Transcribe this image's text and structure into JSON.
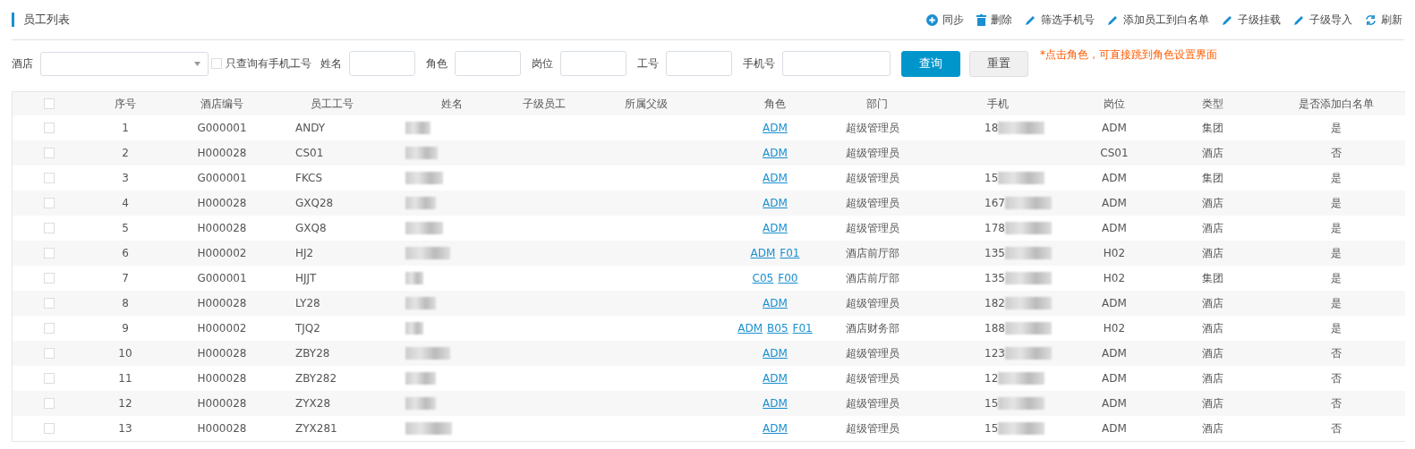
{
  "header": {
    "title": "员工列表",
    "actions": [
      {
        "kind": "add",
        "label": "同步"
      },
      {
        "kind": "delete",
        "label": "删除"
      },
      {
        "kind": "edit",
        "label": "筛选手机号"
      },
      {
        "kind": "edit",
        "label": "添加员工到白名单"
      },
      {
        "kind": "edit",
        "label": "子级挂载"
      },
      {
        "kind": "edit",
        "label": "子级导入"
      },
      {
        "kind": "refresh",
        "label": "刷新"
      }
    ]
  },
  "filters": {
    "hotel_label": "酒店",
    "phone_only": {
      "label": "只查询有手机工号",
      "checked": false
    },
    "fields": [
      {
        "label": "姓名"
      },
      {
        "label": "角色"
      },
      {
        "label": "岗位"
      },
      {
        "label": "工号"
      },
      {
        "label": "手机号"
      }
    ],
    "search_button": "查询",
    "reset_button": "重置",
    "note": "*点击角色，可直接跳到角色设置界面"
  },
  "table": {
    "header_checked": false,
    "columns": [
      "序号",
      "酒店编号",
      "员工工号",
      "姓名",
      "子级员工",
      "所属父级",
      "角色",
      "部门",
      "手机",
      "岗位",
      "类型",
      "是否添加白名单"
    ],
    "rows": [
      {
        "checked": false,
        "no": "1",
        "hotel": "G000001",
        "emp": "ANDY",
        "roles": [
          "ADM"
        ],
        "dept": "超级管理员",
        "phone": "18",
        "post": "ADM",
        "type": "集团",
        "whitelist": "是"
      },
      {
        "checked": false,
        "no": "2",
        "hotel": "H000028",
        "emp": "CS01",
        "roles": [
          "ADM"
        ],
        "dept": "超级管理员",
        "post": "CS01",
        "type": "酒店",
        "whitelist": "否"
      },
      {
        "checked": false,
        "no": "3",
        "hotel": "G000001",
        "emp": "FKCS",
        "roles": [
          "ADM"
        ],
        "dept": "超级管理员",
        "phone": "15",
        "post": "ADM",
        "type": "集团",
        "whitelist": "是"
      },
      {
        "checked": false,
        "no": "4",
        "hotel": "H000028",
        "emp": "GXQ28",
        "roles": [
          "ADM"
        ],
        "dept": "超级管理员",
        "phone": "167",
        "post": "ADM",
        "type": "酒店",
        "whitelist": "是"
      },
      {
        "checked": false,
        "no": "5",
        "hotel": "H000028",
        "emp": "GXQ8",
        "roles": [
          "ADM"
        ],
        "dept": "超级管理员",
        "phone": "178",
        "post": "ADM",
        "type": "酒店",
        "whitelist": "是"
      },
      {
        "checked": false,
        "no": "6",
        "hotel": "H000002",
        "emp": "HJ2",
        "roles": [
          "ADM",
          "F01"
        ],
        "dept": "酒店前厅部",
        "phone": "135",
        "post": "H02",
        "type": "酒店",
        "whitelist": "是"
      },
      {
        "checked": false,
        "no": "7",
        "hotel": "G000001",
        "emp": "HJJT",
        "roles": [
          "C05",
          "F00"
        ],
        "dept": "酒店前厅部",
        "phone": "135",
        "post": "H02",
        "type": "集团",
        "whitelist": "是"
      },
      {
        "checked": false,
        "no": "8",
        "hotel": "H000028",
        "emp": "LY28",
        "roles": [
          "ADM"
        ],
        "dept": "超级管理员",
        "phone": "182",
        "post": "ADM",
        "type": "酒店",
        "whitelist": "是"
      },
      {
        "checked": false,
        "no": "9",
        "hotel": "H000002",
        "emp": "TJQ2",
        "roles": [
          "ADM",
          "B05",
          "F01"
        ],
        "dept": "酒店财务部",
        "phone": "188",
        "post": "H02",
        "type": "酒店",
        "whitelist": "是"
      },
      {
        "checked": false,
        "no": "10",
        "hotel": "H000028",
        "emp": "ZBY28",
        "roles": [
          "ADM"
        ],
        "dept": "超级管理员",
        "phone": "123",
        "post": "ADM",
        "type": "酒店",
        "whitelist": "否"
      },
      {
        "checked": false,
        "no": "11",
        "hotel": "H000028",
        "emp": "ZBY282",
        "roles": [
          "ADM"
        ],
        "dept": "超级管理员",
        "phone": "12",
        "post": "ADM",
        "type": "酒店",
        "whitelist": "否"
      },
      {
        "checked": false,
        "no": "12",
        "hotel": "H000028",
        "emp": "ZYX28",
        "roles": [
          "ADM"
        ],
        "dept": "超级管理员",
        "phone": "15",
        "post": "ADM",
        "type": "酒店",
        "whitelist": "否"
      },
      {
        "checked": false,
        "no": "13",
        "hotel": "H000028",
        "emp": "ZYX281",
        "roles": [
          "ADM"
        ],
        "dept": "超级管理员",
        "phone": "15",
        "post": "ADM",
        "type": "酒店",
        "whitelist": "否"
      }
    ]
  }
}
